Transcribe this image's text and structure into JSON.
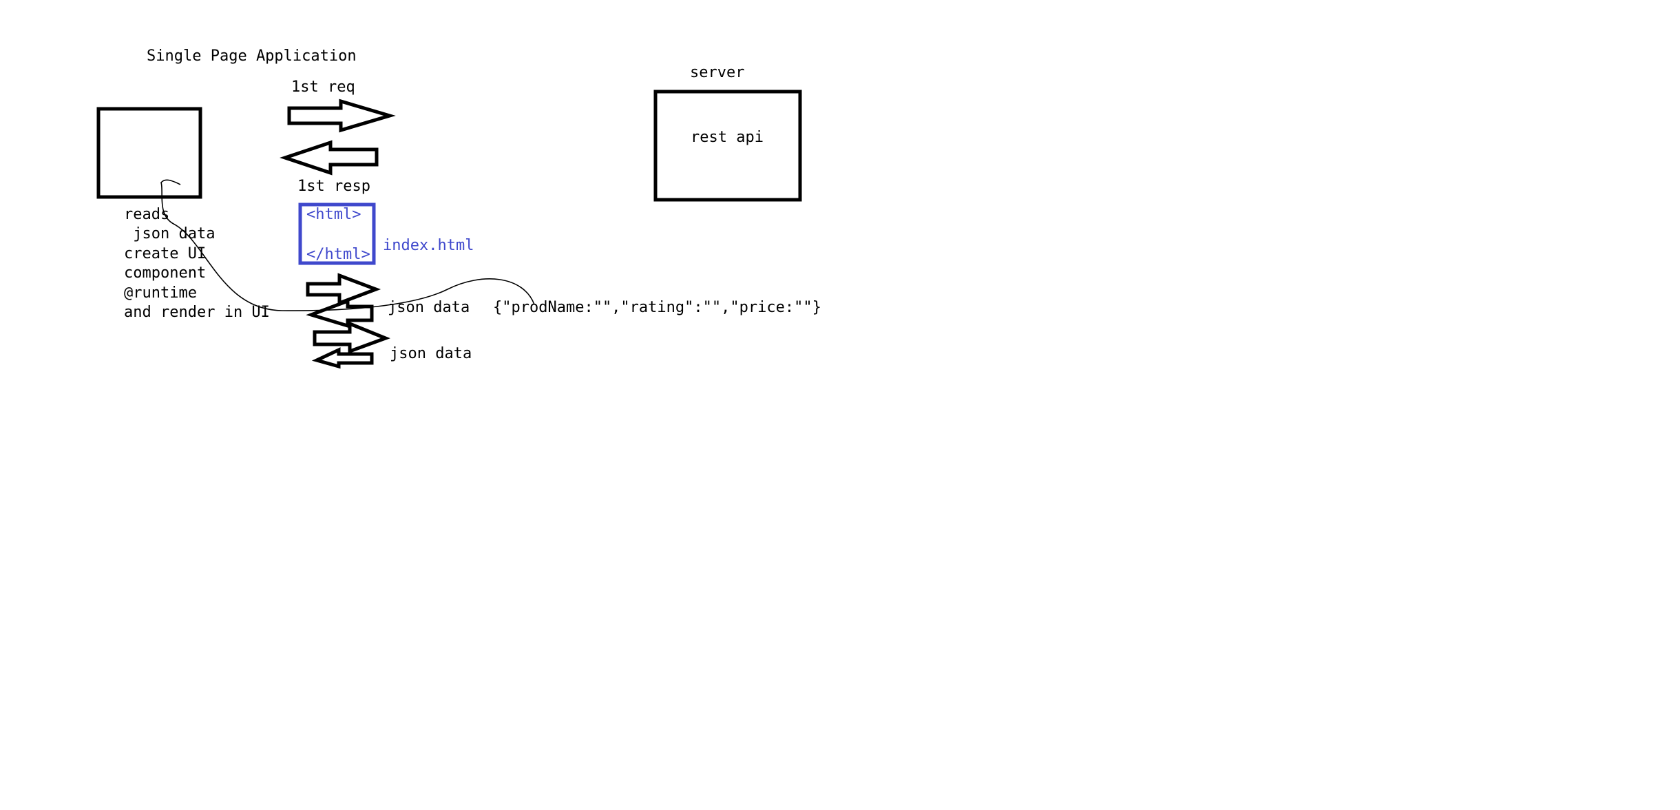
{
  "colors": {
    "ink": "#000000",
    "html_box": "#3f48cc",
    "background": "#ffffff"
  },
  "diagram": {
    "title": "Single Page Application",
    "server_label": "server",
    "server_box_text": "rest api",
    "first_request": "1st req",
    "first_response": "1st resp",
    "html_open": "<html>",
    "html_close": "</html>",
    "index_file": "index.html",
    "client_notes": [
      "reads",
      " json data",
      "create UI",
      "component",
      "@runtime",
      "and render in UI"
    ],
    "json_label_1": "json data",
    "json_sample": "{\"prodName:\"\",\"rating\":\"\",\"price:\"\"}",
    "json_label_2": "json data"
  }
}
